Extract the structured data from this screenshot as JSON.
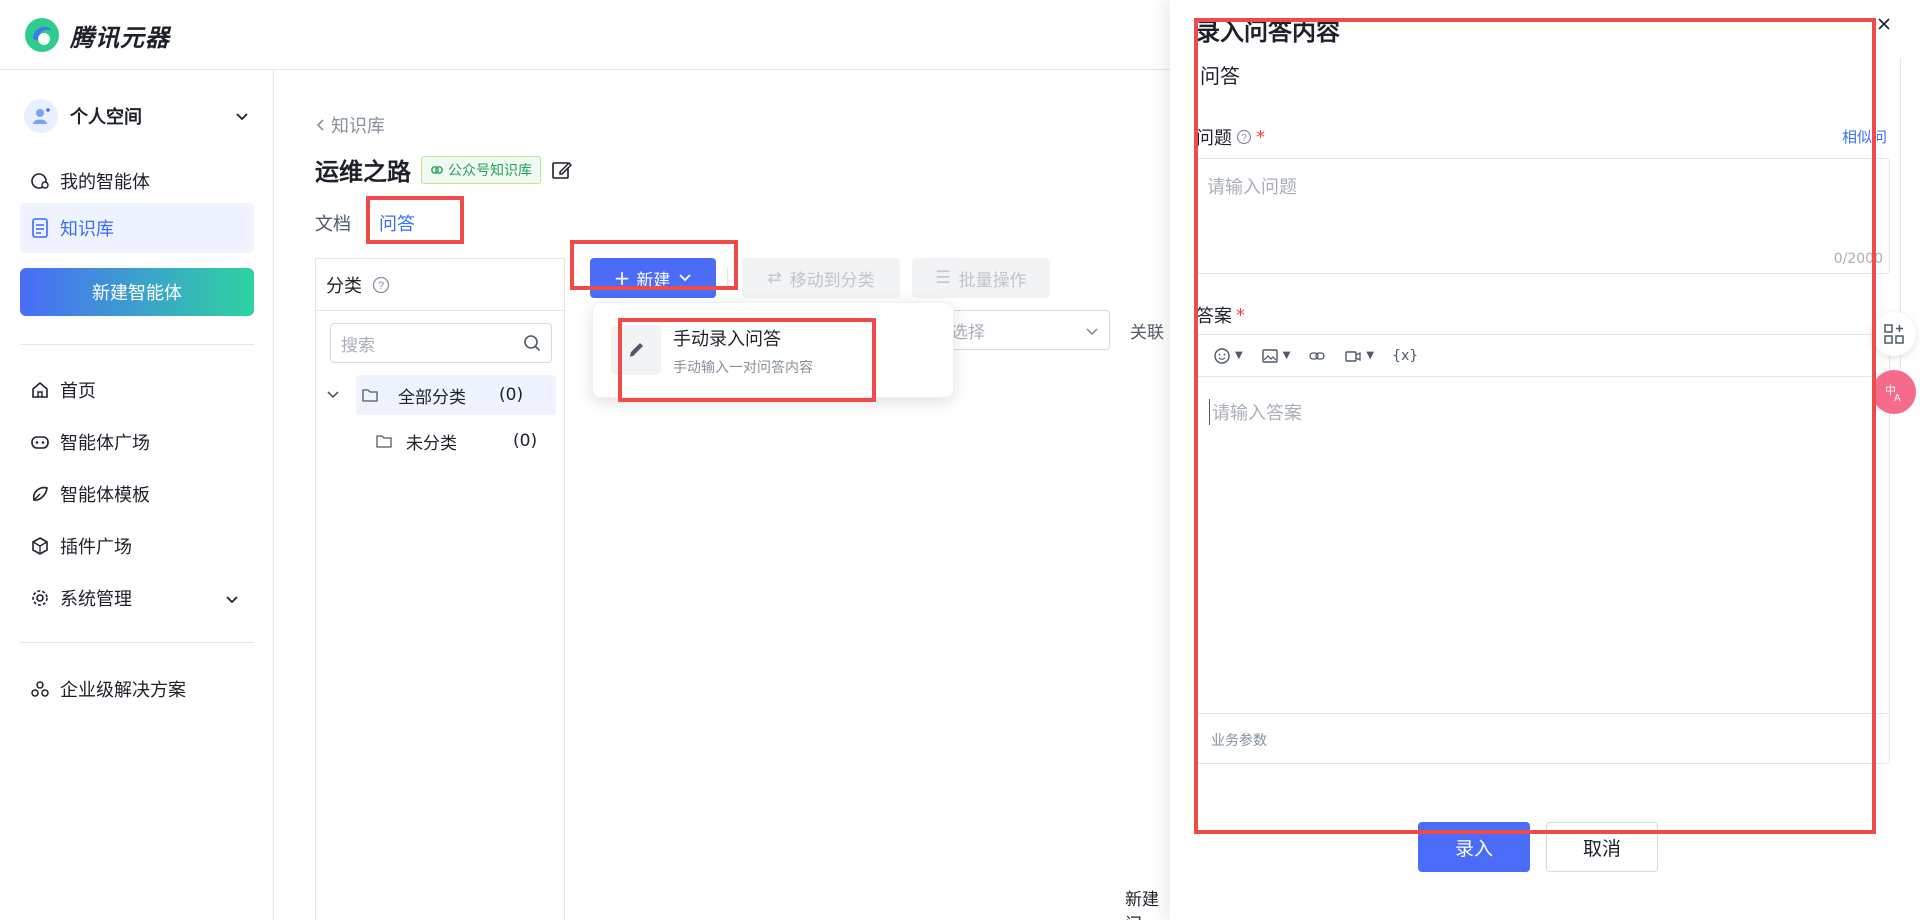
{
  "app": {
    "name": "腾讯元器"
  },
  "sidebar": {
    "space_label": "个人空间",
    "items_top": [
      {
        "label": "我的智能体",
        "icon": "agent-icon"
      },
      {
        "label": "知识库",
        "icon": "document-icon",
        "active": true
      }
    ],
    "new_agent_label": "新建智能体",
    "items_main": [
      {
        "label": "首页",
        "icon": "home-icon"
      },
      {
        "label": "智能体广场",
        "icon": "robot-icon"
      },
      {
        "label": "智能体模板",
        "icon": "template-icon"
      },
      {
        "label": "插件广场",
        "icon": "plugin-icon"
      },
      {
        "label": "系统管理",
        "icon": "gear-icon"
      }
    ],
    "enterprise_label": "企业级解决方案"
  },
  "main": {
    "breadcrumb": "知识库",
    "title": "运维之路",
    "tag": "公众号知识库",
    "tabs": [
      {
        "label": "文档",
        "active": false
      },
      {
        "label": "问答",
        "active": true
      }
    ],
    "category_title": "分类",
    "search_placeholder": "搜索",
    "tree": [
      {
        "label": "全部分类",
        "count": "(0)"
      },
      {
        "label": "未分类",
        "count": "(0)"
      }
    ],
    "toolbar": {
      "new_label": "新建",
      "move_label": "移动到分类",
      "batch_label": "批量操作"
    },
    "filter_placeholder": "选择",
    "filter_label": "关联",
    "empty_text": "新建问"
  },
  "dropdown": {
    "title": "手动录入问答",
    "subtitle": "手动输入一对问答内容"
  },
  "drawer": {
    "title": "录入问答内容",
    "section": "问答",
    "question_label": "问题",
    "similar_link": "相似问",
    "question_placeholder": "请输入问题",
    "question_count": "0/2000",
    "answer_label": "答案",
    "answer_placeholder": "请输入答案",
    "toolbar_var": "{x}",
    "params_label": "业务参数",
    "submit_label": "录入",
    "cancel_label": "取消"
  },
  "colors": {
    "primary": "#4a6cf7",
    "annotation": "#ef4b4b",
    "tag_green": "#23a35a"
  }
}
